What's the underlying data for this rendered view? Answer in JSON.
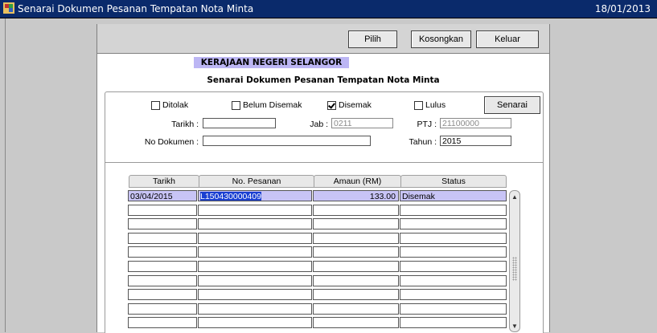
{
  "window": {
    "title": "Senarai Dokumen Pesanan Tempatan Nota Minta",
    "date": "18/01/2013",
    "icon": "app-window-icon"
  },
  "toolbar": {
    "pilih_label": "Pilih",
    "kosongkan_label": "Kosongkan",
    "keluar_label": "Keluar"
  },
  "header": {
    "org": "KERAJAAN NEGERI SELANGOR",
    "subtitle": "Senarai Dokumen Pesanan Tempatan Nota Minta"
  },
  "filters": {
    "ditolak": {
      "label": "Ditolak",
      "checked": false
    },
    "belum_disemak": {
      "label": "Belum Disemak",
      "checked": false
    },
    "disemak": {
      "label": "Disemak",
      "checked": true
    },
    "lulus": {
      "label": "Lulus",
      "checked": false
    },
    "senarai_label": "Senarai",
    "tarikh_label": "Tarikh :",
    "tarikh_value": "",
    "jab_label": "Jab :",
    "jab_value": "0211",
    "ptj_label": "PTJ :",
    "ptj_value": "21100000",
    "no_dokumen_label": "No Dokumen :",
    "no_dokumen_value": "",
    "tahun_label": "Tahun :",
    "tahun_value": "2015"
  },
  "table": {
    "columns": [
      "Tarikh",
      "No. Pesanan",
      "Amaun (RM)",
      "Status"
    ],
    "rows": [
      {
        "tarikh": "03/04/2015",
        "no_pesanan": "L150430000409",
        "amaun": "133.00",
        "status": "Disemak"
      },
      {
        "tarikh": "",
        "no_pesanan": "",
        "amaun": "",
        "status": ""
      },
      {
        "tarikh": "",
        "no_pesanan": "",
        "amaun": "",
        "status": ""
      },
      {
        "tarikh": "",
        "no_pesanan": "",
        "amaun": "",
        "status": ""
      },
      {
        "tarikh": "",
        "no_pesanan": "",
        "amaun": "",
        "status": ""
      },
      {
        "tarikh": "",
        "no_pesanan": "",
        "amaun": "",
        "status": ""
      },
      {
        "tarikh": "",
        "no_pesanan": "",
        "amaun": "",
        "status": ""
      },
      {
        "tarikh": "",
        "no_pesanan": "",
        "amaun": "",
        "status": ""
      },
      {
        "tarikh": "",
        "no_pesanan": "",
        "amaun": "",
        "status": ""
      },
      {
        "tarikh": "",
        "no_pesanan": "",
        "amaun": "",
        "status": ""
      }
    ]
  },
  "colors": {
    "titlebar": "#0a2a6b",
    "header_band": "#bcb6f4",
    "selected_row": "#c8c4f6",
    "highlight": "#1a3fd1"
  }
}
